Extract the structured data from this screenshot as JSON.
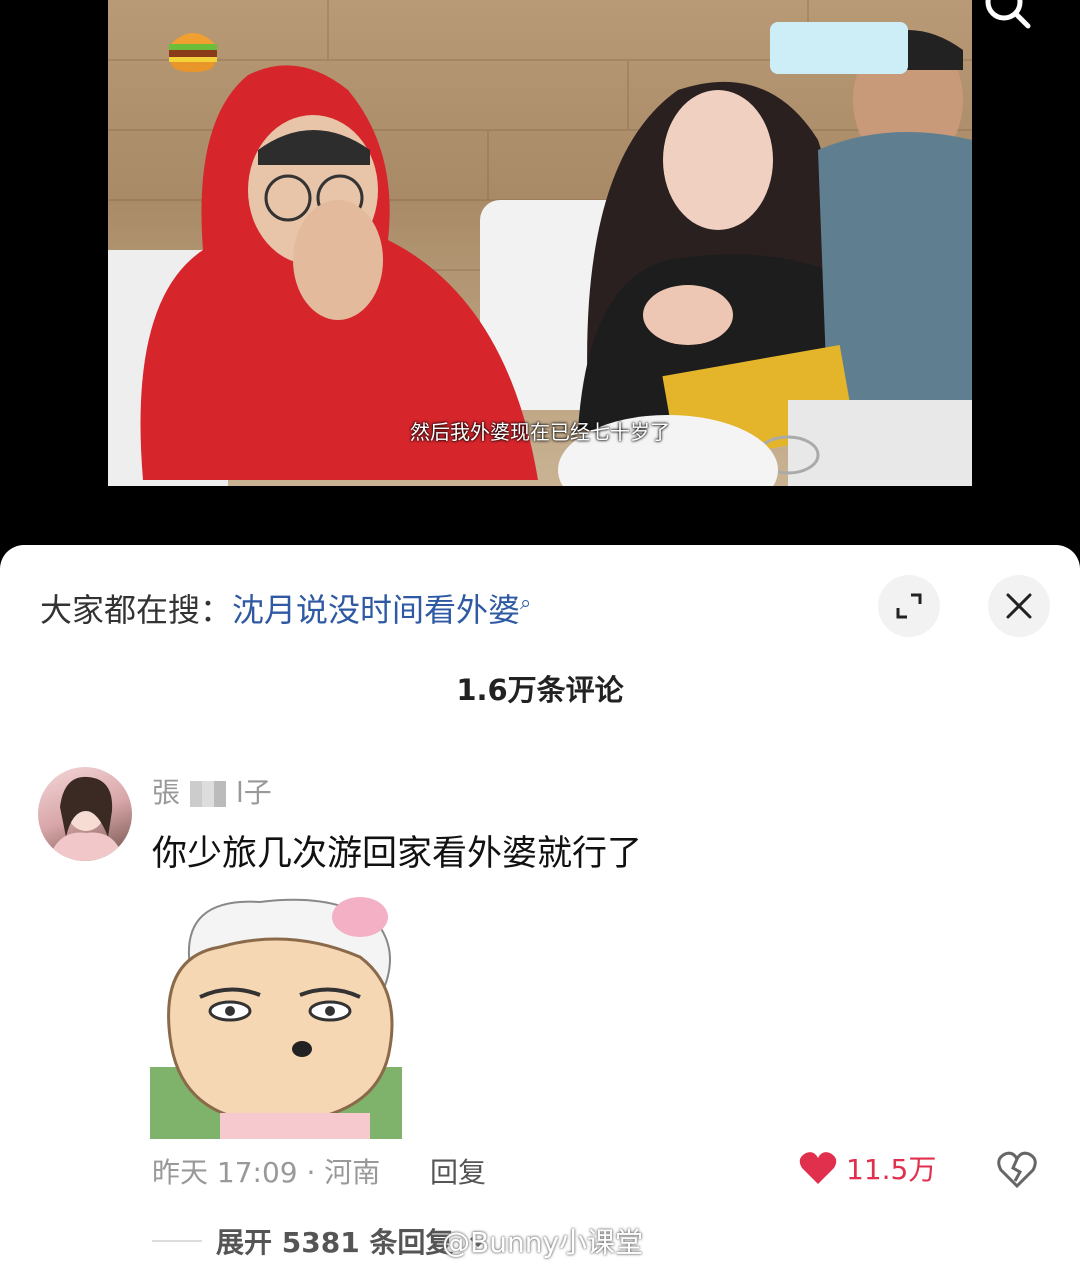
{
  "video": {
    "subtitle": "然后我外婆现在已经七十岁了"
  },
  "header": {
    "trending_prefix": "大家都在搜：",
    "trending_query": "沈月说没时间看外婆"
  },
  "comments": {
    "count_label": "1.6万条评论",
    "item": {
      "username_prefix": "張",
      "username_suffix": "l子",
      "text": "你少旅几次游回家看外婆就行了",
      "time_location": "昨天 17:09 · 河南",
      "reply_label": "回复",
      "like_count": "11.5万",
      "expand_label": "展开 5381 条回复"
    }
  },
  "watermark": "@Bunny小课堂",
  "colors": {
    "link": "#2f5aa3",
    "like": "#e0304e"
  }
}
